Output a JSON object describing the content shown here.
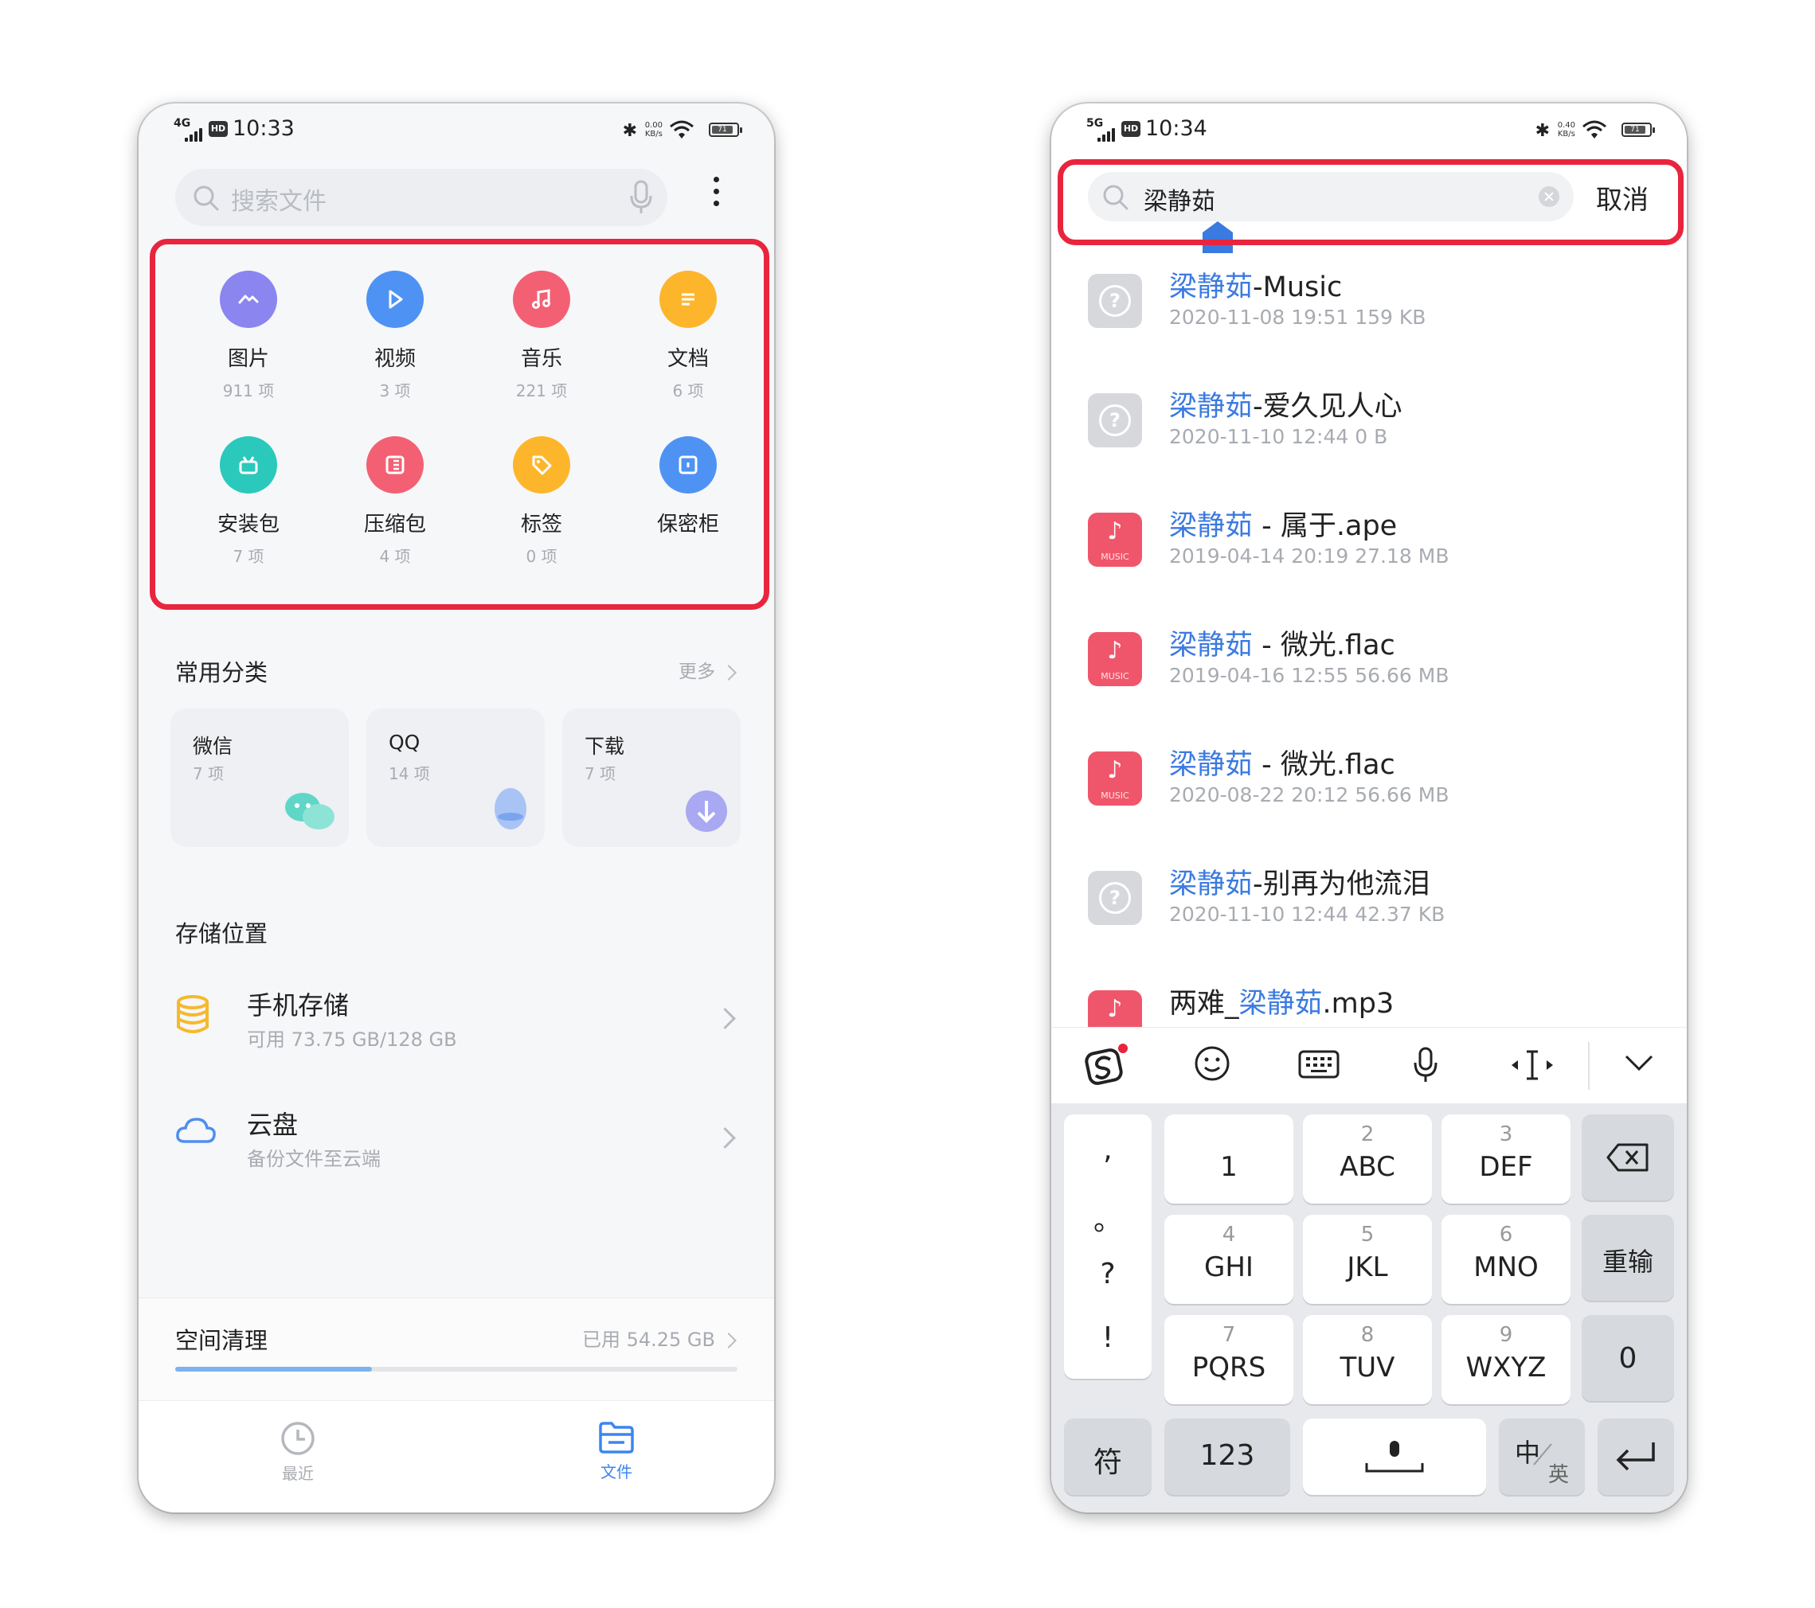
{
  "left_screen": {
    "status": {
      "network": "4G",
      "hd": "HD",
      "time": "10:33",
      "speed": "0.00\nKB/s",
      "battery": "71"
    },
    "search": {
      "placeholder": "搜索文件"
    },
    "categories": [
      {
        "label": "图片",
        "count": "911 项",
        "color": "#8b85f0",
        "icon": "image-icon"
      },
      {
        "label": "视频",
        "count": "3 项",
        "color": "#4e93f4",
        "icon": "play-icon"
      },
      {
        "label": "音乐",
        "count": "221 项",
        "color": "#f46073",
        "icon": "music-icon"
      },
      {
        "label": "文档",
        "count": "6 项",
        "color": "#fdb62b",
        "icon": "document-icon"
      },
      {
        "label": "安装包",
        "count": "7 项",
        "color": "#2ac9bb",
        "icon": "android-icon"
      },
      {
        "label": "压缩包",
        "count": "4 项",
        "color": "#f46073",
        "icon": "archive-icon"
      },
      {
        "label": "标签",
        "count": "0 项",
        "color": "#fdb62b",
        "icon": "tag-icon"
      },
      {
        "label": "保密柜",
        "count": "",
        "color": "#4e93f4",
        "icon": "safe-icon"
      }
    ],
    "common": {
      "title": "常用分类",
      "more": "更多",
      "cards": [
        {
          "title": "微信",
          "count": "7 项",
          "icon": "wechat-icon"
        },
        {
          "title": "QQ",
          "count": "14 项",
          "icon": "qq-icon"
        },
        {
          "title": "下载",
          "count": "7 项",
          "icon": "download-icon"
        }
      ]
    },
    "storage": {
      "title": "存储位置",
      "phone": {
        "name": "手机存储",
        "detail": "可用 73.75 GB/128 GB"
      },
      "cloud": {
        "name": "云盘",
        "detail": "备份文件至云端"
      }
    },
    "clean": {
      "title": "空间清理",
      "used": "已用 54.25 GB",
      "progress": 0.35
    },
    "tabs": [
      {
        "label": "最近",
        "active": false
      },
      {
        "label": "文件",
        "active": true
      }
    ]
  },
  "right_screen": {
    "status": {
      "network": "5G",
      "hd": "HD",
      "time": "10:34",
      "speed": "0.40\nKB/s",
      "battery": "71"
    },
    "search": {
      "query": "梁静茹",
      "cancel": "取消"
    },
    "results": [
      {
        "type": "unknown",
        "pre": "",
        "hl": "梁静茹",
        "post": "-Music",
        "meta": "2020-11-08 19:51   159 KB"
      },
      {
        "type": "unknown",
        "pre": "",
        "hl": "梁静茹",
        "post": "-爱久见人心",
        "meta": "2020-11-10 12:44   0 B"
      },
      {
        "type": "music",
        "pre": "",
        "hl": "梁静茹",
        "post": " - 属于.ape",
        "meta": "2019-04-14 20:19   27.18 MB"
      },
      {
        "type": "music",
        "pre": "",
        "hl": "梁静茹",
        "post": " - 微光.flac",
        "meta": "2019-04-16 12:55   56.66 MB"
      },
      {
        "type": "music",
        "pre": "",
        "hl": "梁静茹",
        "post": " - 微光.flac",
        "meta": "2020-08-22 20:12   56.66 MB"
      },
      {
        "type": "unknown",
        "pre": "",
        "hl": "梁静茹",
        "post": "-别再为他流泪",
        "meta": "2020-11-10 12:44   42.37 KB"
      },
      {
        "type": "music",
        "pre": "两难_",
        "hl": "梁静茹",
        "post": ".mp3",
        "meta": ""
      }
    ],
    "music_label": "MUSIC",
    "keyboard": {
      "punct": [
        ",",
        "。",
        "?",
        "!"
      ],
      "keys": [
        {
          "num": "",
          "letters": "1"
        },
        {
          "num": "2",
          "letters": "ABC"
        },
        {
          "num": "3",
          "letters": "DEF"
        },
        {
          "num": "4",
          "letters": "GHI"
        },
        {
          "num": "5",
          "letters": "JKL"
        },
        {
          "num": "6",
          "letters": "MNO"
        },
        {
          "num": "7",
          "letters": "PQRS"
        },
        {
          "num": "8",
          "letters": "TUV"
        },
        {
          "num": "9",
          "letters": "WXYZ"
        }
      ],
      "reenter": "重输",
      "zero": "0",
      "symbols": "符",
      "numbers": "123",
      "lang_zh": "中",
      "lang_en": "英"
    }
  }
}
